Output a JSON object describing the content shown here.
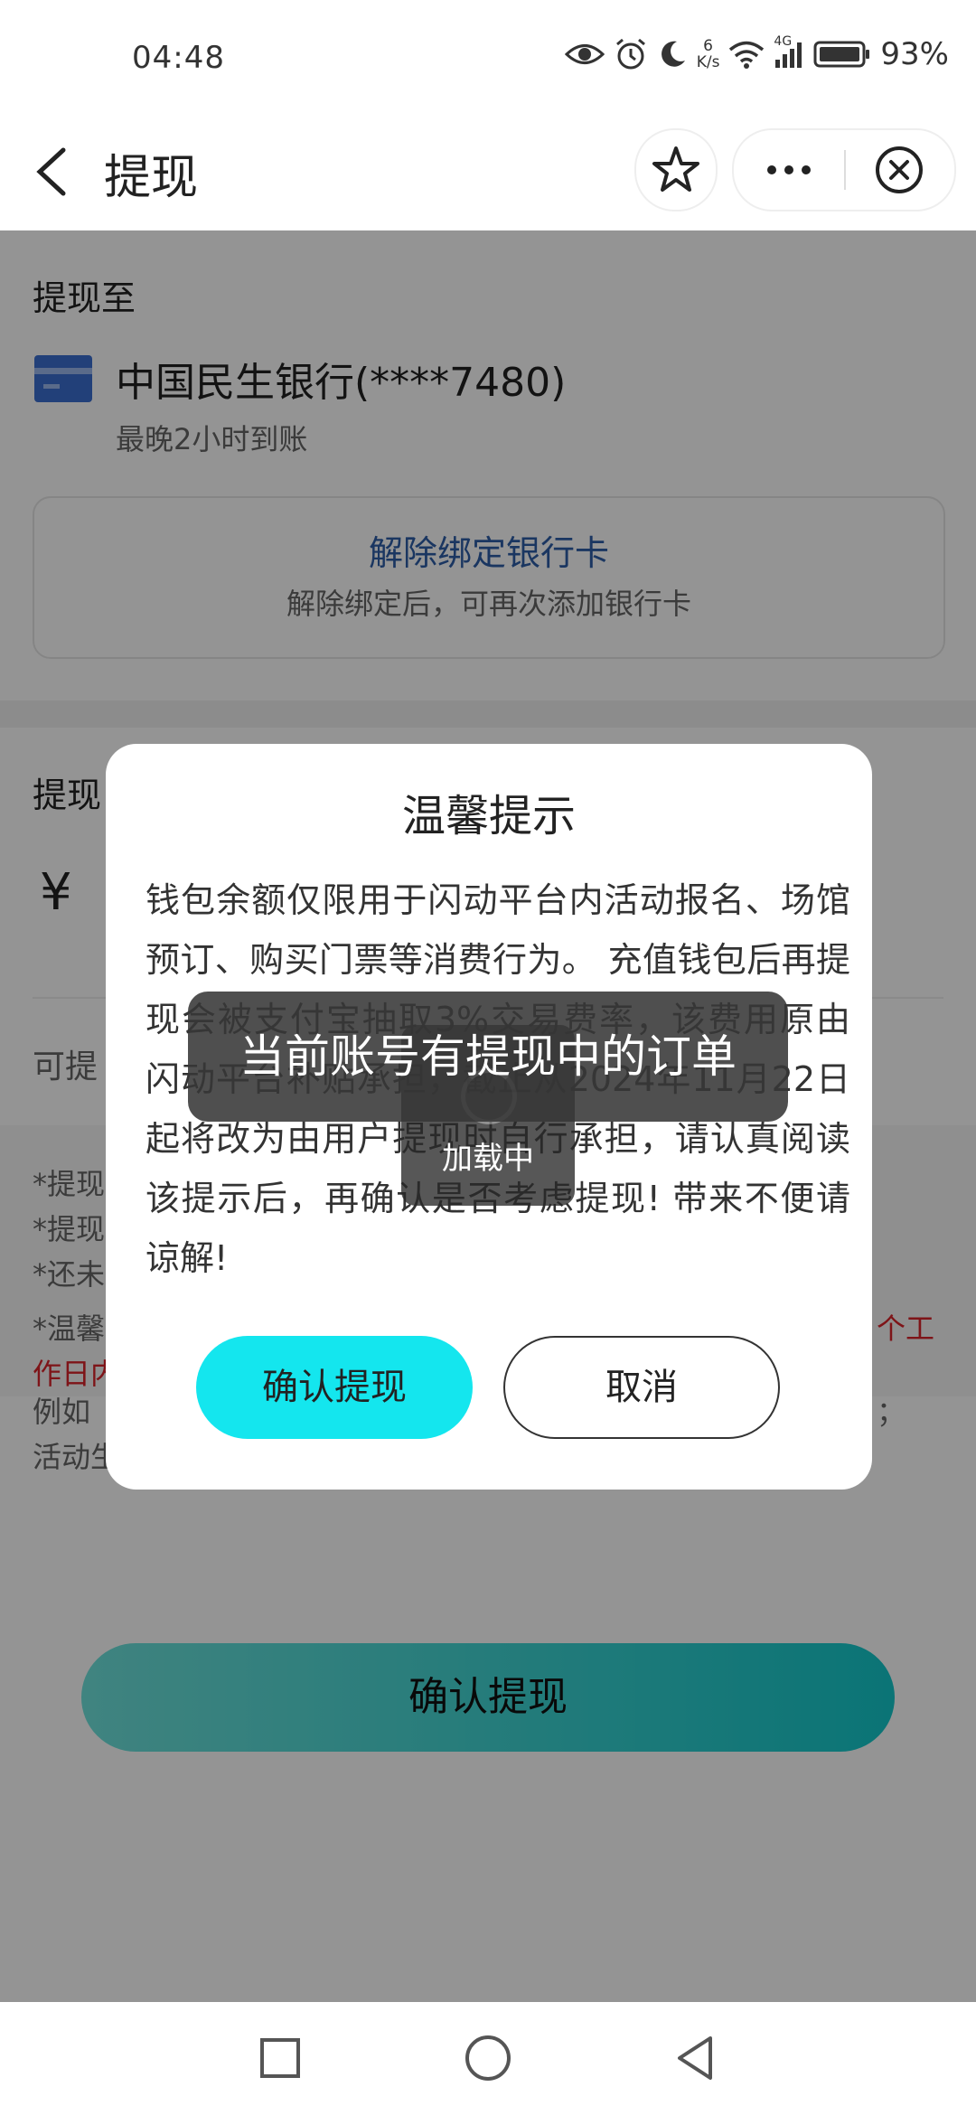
{
  "status_bar": {
    "time": "04:48",
    "net_speed_value": "6",
    "net_speed_unit": "K/s",
    "network_type": "4G",
    "battery": "93%",
    "icons": [
      "eye-icon",
      "alarm-icon",
      "moon-icon",
      "net-speed-icon",
      "wifi-icon",
      "signal-icon",
      "battery-icon"
    ]
  },
  "header": {
    "title": "提现",
    "icons": [
      "back-icon",
      "star-icon",
      "more-icon",
      "close-circle-icon"
    ]
  },
  "withdraw": {
    "to_label": "提现至",
    "bank_name": "中国民生银行(****7480)",
    "arrival_time": "最晚2小时到账",
    "unbind_title": "解除绑定银行卡",
    "unbind_subtitle": "解除绑定后，可再次添加银行卡",
    "amount_label_partial": "提现",
    "currency_symbol": "¥",
    "available_partial": "可提",
    "notes_partial": [
      "*提现",
      "*提现",
      "*还未",
      "*温馨",
      "作日内",
      "例如",
      "活动生"
    ],
    "note_red_partial": "个工",
    "note_tail": "；",
    "confirm_button": "确认提现"
  },
  "dialog": {
    "title": "温馨提示",
    "body": "钱包余额仅限用于闪动平台内活动报名、场馆预订、购买门票等消费行为。 充值钱包后再提现会被支付宝抽取3%交易费率，该费用原由闪动平台补贴承担，截止从2024年11月22日起将改为由用户提现时自行承担，请认真阅读该提示后，再确认是否考虑提现! 带来不便请谅解!",
    "confirm": "确认提现",
    "cancel": "取消"
  },
  "loading": {
    "text": "加载中"
  },
  "toast": {
    "text": "当前账号有提现中的订单"
  },
  "nav_bar": {
    "icons": [
      "recents-square-icon",
      "home-circle-icon",
      "back-triangle-icon"
    ]
  },
  "colors": {
    "accent_cyan": "#14e6ee",
    "link_blue": "#2d5ea8",
    "warning_red": "#d9232a",
    "bank_blue": "#3c6fd0"
  }
}
